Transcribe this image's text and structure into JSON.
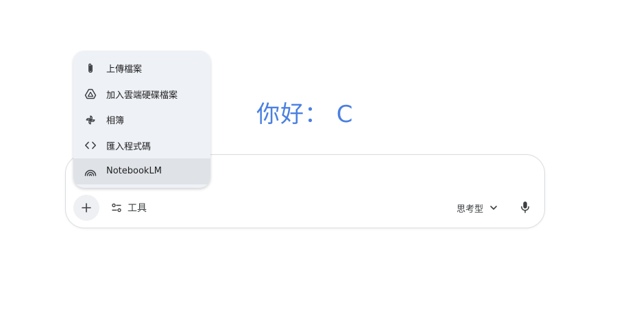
{
  "greeting": "你好： C",
  "menu": {
    "items": [
      {
        "label": "上傳檔案",
        "icon": "paperclip-icon"
      },
      {
        "label": "加入雲端硬碟檔案",
        "icon": "google-drive-icon"
      },
      {
        "label": "相簿",
        "icon": "photos-pinwheel-icon"
      },
      {
        "label": "匯入程式碼",
        "icon": "code-icon"
      },
      {
        "label": "NotebookLM",
        "icon": "notebooklm-icon",
        "highlighted": true
      }
    ]
  },
  "composer": {
    "add_icon": "plus-icon",
    "tools_label": "工具",
    "tools_icon": "sliders-icon",
    "mode_label": "思考型",
    "mode_icon": "chevron-down-icon",
    "mic_icon": "microphone-icon"
  },
  "colors": {
    "greeting": "#4a80e0",
    "menu_background": "#eef1f6",
    "menu_highlight": "#dfe2e7",
    "plus_button_background": "#eef0f3"
  }
}
